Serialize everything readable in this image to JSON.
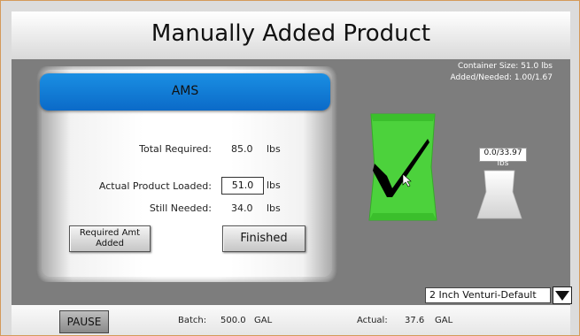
{
  "header": {
    "title": "Manually Added Product"
  },
  "panel": {
    "heading": "AMS",
    "total_required_label": "Total Required:",
    "total_required_value": "85.0",
    "total_required_unit": "lbs",
    "actual_loaded_label": "Actual Product Loaded:",
    "actual_loaded_value": "51.0",
    "actual_loaded_unit": "lbs",
    "still_needed_label": "Still Needed:",
    "still_needed_value": "34.0",
    "still_needed_unit": "lbs",
    "required_amt_added_label": "Required Amt Added",
    "finished_label": "Finished"
  },
  "info": {
    "container_size": "Container Size: 51.0 lbs",
    "added_needed": "Added/Needed: 1.00/1.67"
  },
  "empty_bag": {
    "amount": "0.0/33.97",
    "unit": "lbs"
  },
  "venturi": {
    "selected": "2 Inch Venturi-Default"
  },
  "footer": {
    "pause_label": "PAUSE",
    "batch_label": "Batch:",
    "batch_value": "500.0",
    "batch_unit": "GAL",
    "actual_label": "Actual:",
    "actual_value": "37.6",
    "actual_unit": "GAL"
  },
  "colors": {
    "accent_blue": "#1a8fe3",
    "bag_green": "#4cd23c",
    "main_bg": "#7d7d7d"
  }
}
